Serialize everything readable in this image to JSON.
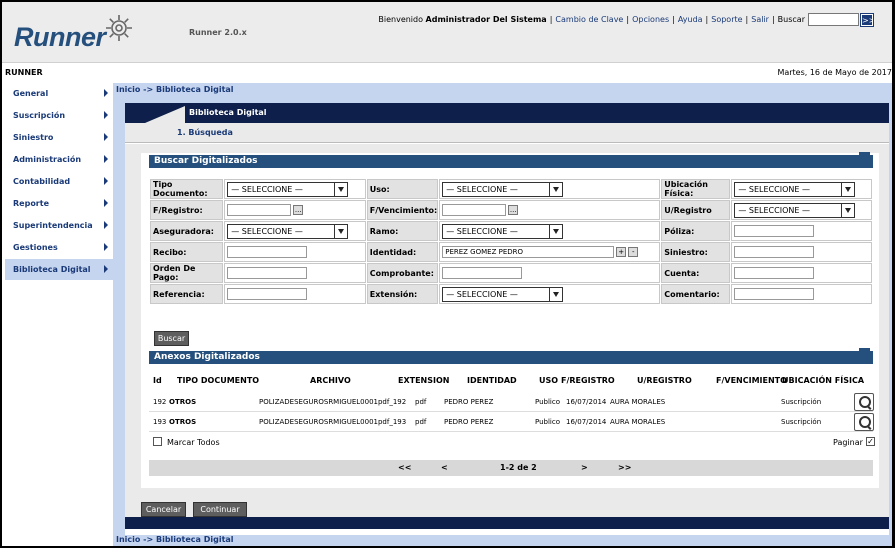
{
  "header": {
    "logo": "Runner",
    "version": "Runner 2.0.x",
    "welcome_prefix": "Bienvenido",
    "user": "Administrador Del Sistema",
    "links": [
      "Cambio de Clave",
      "Opciones",
      "Ayuda",
      "Soporte",
      "Salir"
    ],
    "search_label": "Buscar",
    "search_go": ">>"
  },
  "app_name": "RUNNER",
  "date": "Martes, 16 de Mayo de 2017",
  "sidebar": {
    "items": [
      {
        "label": "General"
      },
      {
        "label": "Suscripción"
      },
      {
        "label": "Siniestro"
      },
      {
        "label": "Administración"
      },
      {
        "label": "Contabilidad"
      },
      {
        "label": "Reporte"
      },
      {
        "label": "Superintendencia"
      },
      {
        "label": "Gestiones"
      },
      {
        "label": "Biblioteca Digital"
      }
    ],
    "active": "Biblioteca Digital"
  },
  "breadcrumb": "Inicio -> Biblioteca Digital",
  "panel": {
    "title": "Biblioteca Digital",
    "step": "1. Búsqueda"
  },
  "search_section": {
    "title": "Buscar Digitalizados",
    "fields": {
      "tipo_documento": {
        "label": "Tipo Documento:",
        "value": "— SELECCIONE —"
      },
      "uso": {
        "label": "Uso:",
        "value": "— SELECCIONE —"
      },
      "ubicacion_fisica": {
        "label": "Ubicación Física:",
        "value": "— SELECCIONE —"
      },
      "f_registro": {
        "label": "F/Registro:",
        "value": ""
      },
      "f_vencimiento": {
        "label": "F/Vencimiento:",
        "value": ""
      },
      "u_registro": {
        "label": "U/Registro",
        "value": "— SELECCIONE —"
      },
      "aseguradora": {
        "label": "Aseguradora:",
        "value": "— SELECCIONE —"
      },
      "ramo": {
        "label": "Ramo:",
        "value": "— SELECCIONE —"
      },
      "poliza": {
        "label": "Póliza:",
        "value": ""
      },
      "recibo": {
        "label": "Recibo:",
        "value": ""
      },
      "identidad": {
        "label": "Identidad:",
        "value": "PEREZ GOMEZ PEDRO"
      },
      "siniestro": {
        "label": "Siniestro:",
        "value": ""
      },
      "orden_pago": {
        "label": "Orden De Pago:",
        "value": ""
      },
      "comprobante": {
        "label": "Comprobante:",
        "value": ""
      },
      "cuenta": {
        "label": "Cuenta:",
        "value": ""
      },
      "referencia": {
        "label": "Referencia:",
        "value": ""
      },
      "extension": {
        "label": "Extensión:",
        "value": "— SELECCIONE —"
      },
      "comentario": {
        "label": "Comentario:",
        "value": ""
      }
    },
    "date_btn": "...",
    "plus_btn": "+",
    "minus_btn": "-",
    "search_button": "Buscar"
  },
  "results_section": {
    "title": "Anexos Digitalizados",
    "columns": [
      "Id",
      "TIPO DOCUMENTO",
      "ARCHIVO",
      "EXTENSION",
      "IDENTIDAD",
      "USO",
      "F/REGISTRO",
      "U/REGISTRO",
      "F/VENCIMIENTO",
      "UBICACIÓN FÍSICA"
    ],
    "rows": [
      {
        "id": "192",
        "tipo": "OTROS",
        "archivo": "POLIZADESEGUROSRMIGUEL0001pdf_192",
        "ext": "pdf",
        "identidad": "PEDRO PEREZ",
        "uso": "Publico",
        "f_registro": "16/07/2014",
        "u_registro": "AURA MORALES",
        "f_vencimiento": "",
        "ubicacion": "Suscripción"
      },
      {
        "id": "193",
        "tipo": "OTROS",
        "archivo": "POLIZADESEGUROSRMIGUEL0001pdf_193",
        "ext": "pdf",
        "identidad": "PEDRO PEREZ",
        "uso": "Publico",
        "f_registro": "16/07/2014",
        "u_registro": "AURA MORALES",
        "f_vencimiento": "",
        "ubicacion": "Suscripción"
      }
    ],
    "select_all": "Marcar Todos",
    "paginate": "Paginar",
    "pager": {
      "first": "<<",
      "prev": "<",
      "info": "1-2 de 2",
      "next": ">",
      "last": ">>"
    }
  },
  "buttons": {
    "cancel": "Cancelar",
    "continue": "Continuar"
  }
}
